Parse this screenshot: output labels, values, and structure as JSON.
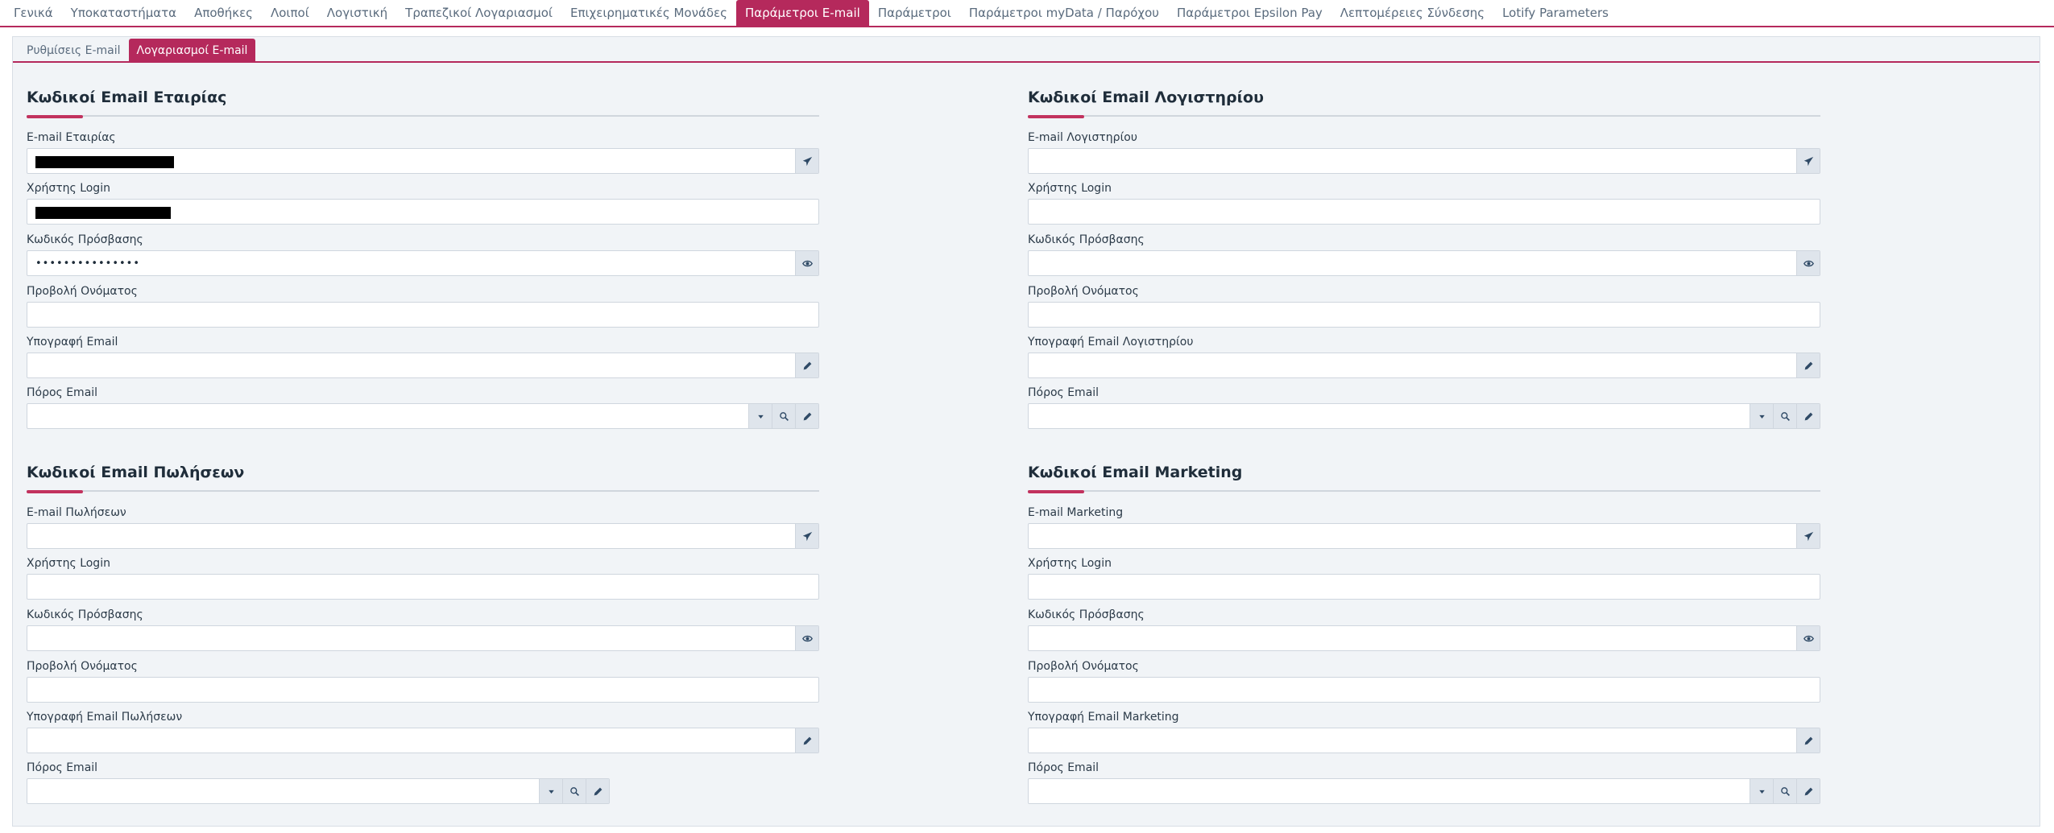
{
  "top_tabs": [
    {
      "label": "Γενικά",
      "active": false
    },
    {
      "label": "Υποκαταστήματα",
      "active": false
    },
    {
      "label": "Αποθήκες",
      "active": false
    },
    {
      "label": "Λοιποί",
      "active": false
    },
    {
      "label": "Λογιστική",
      "active": false
    },
    {
      "label": "Τραπεζικοί Λογαριασμοί",
      "active": false
    },
    {
      "label": "Επιχειρηματικές Μονάδες",
      "active": false
    },
    {
      "label": "Παράμετροι E-mail",
      "active": true
    },
    {
      "label": "Παράμετροι",
      "active": false
    },
    {
      "label": "Παράμετροι myData / Παρόχου",
      "active": false
    },
    {
      "label": "Παράμετροι Epsilon Pay",
      "active": false
    },
    {
      "label": "Λεπτομέρειες Σύνδεσης",
      "active": false
    },
    {
      "label": "Lotify Parameters",
      "active": false
    }
  ],
  "sub_tabs": [
    {
      "label": "Ρυθμίσεις E-mail",
      "active": false
    },
    {
      "label": "Λογαριασμοί E-mail",
      "active": true
    }
  ],
  "accent_color": "#b5295c",
  "sections": {
    "company": {
      "title": "Κωδικοί Email Εταιρίας",
      "email_label": "E-mail Εταιρίας",
      "email_value": "",
      "login_label": "Χρήστης Login",
      "login_value": "",
      "password_label": "Κωδικός Πρόσβασης",
      "password_value": "•••••••••••••••",
      "display_name_label": "Προβολή Ονόματος",
      "display_name_value": "",
      "signature_label": "Υπογραφή Email",
      "signature_value": "",
      "resource_label": "Πόρος Email",
      "resource_value": ""
    },
    "accounting": {
      "title": "Κωδικοί Email Λογιστηρίου",
      "email_label": "E-mail Λογιστηρίου",
      "email_value": "",
      "login_label": "Χρήστης Login",
      "login_value": "",
      "password_label": "Κωδικός Πρόσβασης",
      "password_value": "",
      "display_name_label": "Προβολή Ονόματος",
      "display_name_value": "",
      "signature_label": "Υπογραφή Email Λογιστηρίου",
      "signature_value": "",
      "resource_label": "Πόρος Email",
      "resource_value": ""
    },
    "sales": {
      "title": "Κωδικοί Email Πωλήσεων",
      "email_label": "E-mail Πωλήσεων",
      "email_value": "",
      "login_label": "Χρήστης Login",
      "login_value": "",
      "password_label": "Κωδικός Πρόσβασης",
      "password_value": "",
      "display_name_label": "Προβολή Ονόματος",
      "display_name_value": "",
      "signature_label": "Υπογραφή Email Πωλήσεων",
      "signature_value": "",
      "resource_label": "Πόρος Email",
      "resource_value": ""
    },
    "marketing": {
      "title": "Κωδικοί Email Marketing",
      "email_label": "E-mail Marketing",
      "email_value": "",
      "login_label": "Χρήστης Login",
      "login_value": "",
      "password_label": "Κωδικός Πρόσβασης",
      "password_value": "",
      "display_name_label": "Προβολή Ονόματος",
      "display_name_value": "",
      "signature_label": "Υπογραφή Email Marketing",
      "signature_value": "",
      "resource_label": "Πόρος Email",
      "resource_value": ""
    }
  },
  "icons": {
    "send": "paper-plane-icon",
    "show_password": "eye-icon",
    "edit": "pencil-icon",
    "dropdown": "caret-down-icon",
    "search": "search-icon"
  }
}
